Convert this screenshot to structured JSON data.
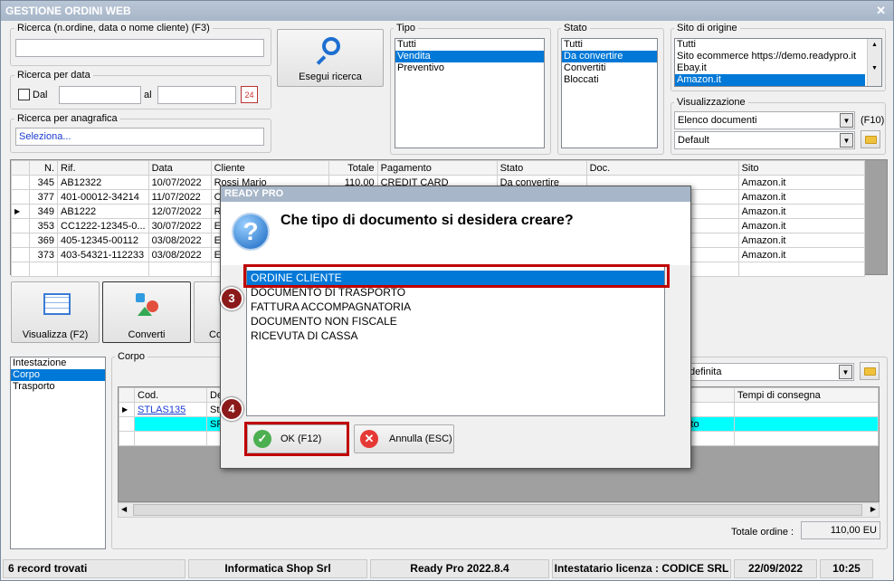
{
  "window": {
    "title": "GESTIONE ORDINI WEB"
  },
  "search": {
    "label": "Ricerca (n.ordine, data o nome cliente) (F3)",
    "value": "",
    "date_label": "Ricerca per data",
    "dal_label": "Dal",
    "al_label": "al",
    "anagrafica_label": "Ricerca per anagrafica",
    "anagrafica_value": "Seleziona...",
    "button_label": "Esegui ricerca"
  },
  "tipo": {
    "label": "Tipo",
    "items": [
      "Tutti",
      "Vendita",
      "Preventivo"
    ],
    "selected": "Vendita"
  },
  "stato": {
    "label": "Stato",
    "items": [
      "Tutti",
      "Da convertire",
      "Convertiti",
      "Bloccati"
    ],
    "selected": "Da convertire"
  },
  "sito": {
    "label": "Sito di origine",
    "items": [
      "Tutti",
      "Sito ecommerce https://demo.readypro.it",
      "Ebay.it",
      "Amazon.it"
    ],
    "selected": "Amazon.it"
  },
  "visualizzazione": {
    "label": "Visualizzazione",
    "combo1": "Elenco documenti",
    "hotkey": "(F10)",
    "combo2": "Default"
  },
  "orders": {
    "columns": [
      "N.",
      "Rif.",
      "Data",
      "Cliente",
      "Totale",
      "Pagamento",
      "Stato",
      "Doc.",
      "Sito"
    ],
    "rows": [
      {
        "n": "345",
        "rif": "AB12322",
        "data": "10/07/2022",
        "cliente": "Rossi Mario",
        "totale": "110,00",
        "pagamento": "CREDIT CARD",
        "stato": "Da convertire",
        "doc": "",
        "sito": "Amazon.it"
      },
      {
        "n": "377",
        "rif": "401-00012-34214",
        "data": "11/07/2022",
        "cliente": "C",
        "totale": "",
        "pagamento": "",
        "stato": "",
        "doc": "",
        "sito": "Amazon.it"
      },
      {
        "n": "349",
        "rif": "AB1222",
        "data": "12/07/2022",
        "cliente": "R",
        "totale": "",
        "pagamento": "",
        "stato": "",
        "doc": "",
        "sito": "Amazon.it"
      },
      {
        "n": "353",
        "rif": "CC1222-12345-0...",
        "data": "30/07/2022",
        "cliente": "E",
        "totale": "",
        "pagamento": "",
        "stato": "",
        "doc": "",
        "sito": "Amazon.it"
      },
      {
        "n": "369",
        "rif": "405-12345-00112",
        "data": "03/08/2022",
        "cliente": "E",
        "totale": "",
        "pagamento": "",
        "stato": "",
        "doc": "",
        "sito": "Amazon.it"
      },
      {
        "n": "373",
        "rif": "403-54321-112233",
        "data": "03/08/2022",
        "cliente": "E",
        "totale": "",
        "pagamento": "",
        "stato": "",
        "doc": "",
        "sito": "Amazon.it"
      }
    ]
  },
  "actions": {
    "visualizza": "Visualizza (F2)",
    "converti": "Converti",
    "partial": "Co"
  },
  "sections": {
    "items": [
      "Intestazione",
      "Corpo",
      "Trasporto"
    ],
    "selected": "Corpo"
  },
  "corpo": {
    "label": "Corpo",
    "combo_text": "definita",
    "columns": [
      "Cod.",
      "De",
      "Tempi di consegna"
    ],
    "rows": [
      {
        "cod": "STLAS135",
        "desc": "St",
        "extra": ""
      },
      {
        "cod": "",
        "desc": "SF",
        "extra": "sporto"
      }
    ],
    "totale_label": "Totale ordine :",
    "totale_value": "110,00 EU"
  },
  "status": {
    "records": "6 record trovati",
    "company": "Informatica Shop Srl",
    "product": "Ready Pro 2022.8.4",
    "license": "Intestatario licenza : CODICE SRL",
    "date": "22/09/2022",
    "time": "10:25"
  },
  "dialog": {
    "title": "READY PRO",
    "question": "Che tipo di documento si desidera creare?",
    "options": [
      "ORDINE CLIENTE",
      "DOCUMENTO DI TRASPORTO",
      "FATTURA ACCOMPAGNATORIA",
      "DOCUMENTO NON FISCALE",
      "RICEVUTA DI CASSA"
    ],
    "selected": "ORDINE CLIENTE",
    "ok_label": "OK (F12)",
    "cancel_label": "Annulla (ESC)"
  },
  "annotations": {
    "step3": "3",
    "step4": "4"
  },
  "colors": {
    "selection": "#0078d7",
    "highlight_row": "#00ffff",
    "annotation_red": "#c00000",
    "badge": "#8b1a1a"
  }
}
